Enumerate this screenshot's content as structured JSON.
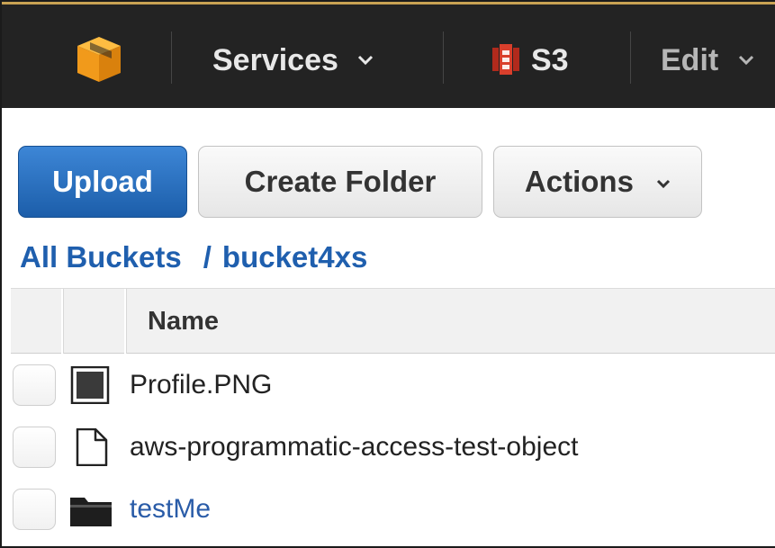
{
  "topbar": {
    "services_label": "Services",
    "s3_label": "S3",
    "edit_label": "Edit"
  },
  "toolbar": {
    "upload_label": "Upload",
    "create_folder_label": "Create Folder",
    "actions_label": "Actions"
  },
  "breadcrumb": {
    "root": "All Buckets",
    "separator": "/",
    "bucket": "bucket4xs"
  },
  "table": {
    "header_name": "Name",
    "rows": [
      {
        "name": "Profile.PNG",
        "icon": "image-file-icon",
        "type": "file"
      },
      {
        "name": "aws-programmatic-access-test-object",
        "icon": "document-icon",
        "type": "file"
      },
      {
        "name": "testMe",
        "icon": "folder-icon",
        "type": "folder"
      }
    ]
  },
  "colors": {
    "topbar_bg": "#232323",
    "aws_logo": "#f3a01b",
    "s3_icon": "#d13a28",
    "upload_blue": "#1f66b7",
    "link_blue": "#1f5fae"
  }
}
